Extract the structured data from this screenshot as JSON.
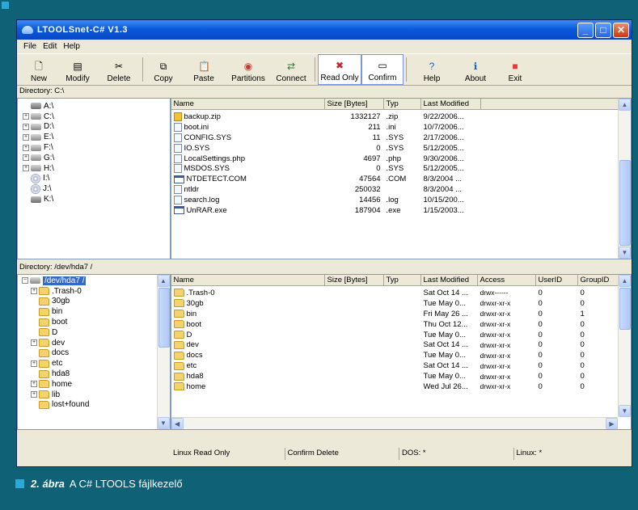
{
  "window": {
    "title": "LTOOLSnet-C# V1.3"
  },
  "menu": [
    "File",
    "Edit",
    "Help"
  ],
  "toolbar": [
    {
      "label": "New",
      "icon": "new-icon"
    },
    {
      "label": "Modify",
      "icon": "modify-icon"
    },
    {
      "label": "Delete",
      "icon": "scissors-icon"
    },
    {
      "label": "Copy",
      "icon": "copy-icon"
    },
    {
      "label": "Paste",
      "icon": "paste-icon"
    },
    {
      "label": "Partitions",
      "icon": "partitions-icon"
    },
    {
      "label": "Connect",
      "icon": "connect-icon"
    },
    {
      "label": "Read Only",
      "icon": "read-only-icon"
    },
    {
      "label": "Confirm",
      "icon": "confirm-icon"
    },
    {
      "label": "Help",
      "icon": "help-icon"
    },
    {
      "label": "About",
      "icon": "about-icon"
    },
    {
      "label": "Exit",
      "icon": "exit-icon"
    }
  ],
  "dos": {
    "directory_label": "Directory: C:\\",
    "tree": [
      "A:\\",
      "C:\\",
      "D:\\",
      "E:\\",
      "F:\\",
      "G:\\",
      "H:\\",
      "I:\\",
      "J:\\",
      "K:\\"
    ],
    "columns": [
      "Name",
      "Size [Bytes]",
      "Typ",
      "Last Modified"
    ],
    "files": [
      {
        "name": "backup.zip",
        "size": "1332127",
        "typ": ".zip",
        "modified": "9/22/2006..."
      },
      {
        "name": "boot.ini",
        "size": "211",
        "typ": ".ini",
        "modified": "10/7/2006..."
      },
      {
        "name": "CONFIG.SYS",
        "size": "11",
        "typ": ".SYS",
        "modified": "2/17/2006..."
      },
      {
        "name": "IO.SYS",
        "size": "0",
        "typ": ".SYS",
        "modified": "5/12/2005..."
      },
      {
        "name": "LocalSettings.php",
        "size": "4697",
        "typ": ".php",
        "modified": "9/30/2006..."
      },
      {
        "name": "MSDOS.SYS",
        "size": "0",
        "typ": ".SYS",
        "modified": "5/12/2005..."
      },
      {
        "name": "NTDETECT.COM",
        "size": "47564",
        "typ": ".COM",
        "modified": "8/3/2004 ..."
      },
      {
        "name": "ntldr",
        "size": "250032",
        "typ": "",
        "modified": "8/3/2004 ..."
      },
      {
        "name": "search.log",
        "size": "14456",
        "typ": ".log",
        "modified": "10/15/200..."
      },
      {
        "name": "UnRAR.exe",
        "size": "187904",
        "typ": ".exe",
        "modified": "1/15/2003..."
      }
    ]
  },
  "linux": {
    "directory_label": "Directory: /dev/hda7 /",
    "tree": [
      {
        "label": "/dev/hda7 /",
        "level": 0,
        "expander": "−"
      },
      {
        "label": ".Trash-0",
        "level": 1,
        "expander": "+"
      },
      {
        "label": "30gb",
        "level": 1,
        "expander": ""
      },
      {
        "label": "bin",
        "level": 1,
        "expander": ""
      },
      {
        "label": "boot",
        "level": 1,
        "expander": ""
      },
      {
        "label": "D",
        "level": 1,
        "expander": ""
      },
      {
        "label": "dev",
        "level": 1,
        "expander": "+"
      },
      {
        "label": "docs",
        "level": 1,
        "expander": ""
      },
      {
        "label": "etc",
        "level": 1,
        "expander": "+"
      },
      {
        "label": "hda8",
        "level": 1,
        "expander": ""
      },
      {
        "label": "home",
        "level": 1,
        "expander": "+"
      },
      {
        "label": "lib",
        "level": 1,
        "expander": "+"
      },
      {
        "label": "lost+found",
        "level": 1,
        "expander": ""
      }
    ],
    "columns": [
      "Name",
      "Size [Bytes]",
      "Typ",
      "Last Modified",
      "Access",
      "UserID",
      "GroupID"
    ],
    "files": [
      {
        "name": ".Trash-0",
        "size": "",
        "typ": "",
        "modified": "Sat Oct 14 ...",
        "access": "drwx------",
        "uid": "0",
        "gid": "0"
      },
      {
        "name": "30gb",
        "size": "",
        "typ": "",
        "modified": "Tue May 0...",
        "access": "drwxr-xr-x",
        "uid": "0",
        "gid": "0"
      },
      {
        "name": "bin",
        "size": "",
        "typ": "",
        "modified": "Fri May 26 ...",
        "access": "drwxr-xr-x",
        "uid": "0",
        "gid": "1"
      },
      {
        "name": "boot",
        "size": "",
        "typ": "",
        "modified": "Thu Oct 12...",
        "access": "drwxr-xr-x",
        "uid": "0",
        "gid": "0"
      },
      {
        "name": "D",
        "size": "",
        "typ": "",
        "modified": "Tue May 0...",
        "access": "drwxr-xr-x",
        "uid": "0",
        "gid": "0"
      },
      {
        "name": "dev",
        "size": "",
        "typ": "",
        "modified": "Sat Oct 14 ...",
        "access": "drwxr-xr-x",
        "uid": "0",
        "gid": "0"
      },
      {
        "name": "docs",
        "size": "",
        "typ": "",
        "modified": "Tue May 0...",
        "access": "drwxr-xr-x",
        "uid": "0",
        "gid": "0"
      },
      {
        "name": "etc",
        "size": "",
        "typ": "",
        "modified": "Sat Oct 14 ...",
        "access": "drwxr-xr-x",
        "uid": "0",
        "gid": "0"
      },
      {
        "name": "hda8",
        "size": "",
        "typ": "",
        "modified": "Tue May 0...",
        "access": "drwxr-xr-x",
        "uid": "0",
        "gid": "0"
      },
      {
        "name": "home",
        "size": "",
        "typ": "",
        "modified": "Wed Jul 26...",
        "access": "drwxr-xr-x",
        "uid": "0",
        "gid": "0"
      }
    ]
  },
  "status": {
    "linux_read_only": "Linux Read Only",
    "confirm_delete": "Confirm Delete",
    "dos": "DOS: *",
    "linux": "Linux: *"
  },
  "caption": {
    "label": "2. ábra",
    "text": "A C# LTOOLS fájlkezelő"
  },
  "colors": {
    "background": "#0f6175",
    "accent": "#2aa8d8",
    "selection": "#316ac5"
  }
}
